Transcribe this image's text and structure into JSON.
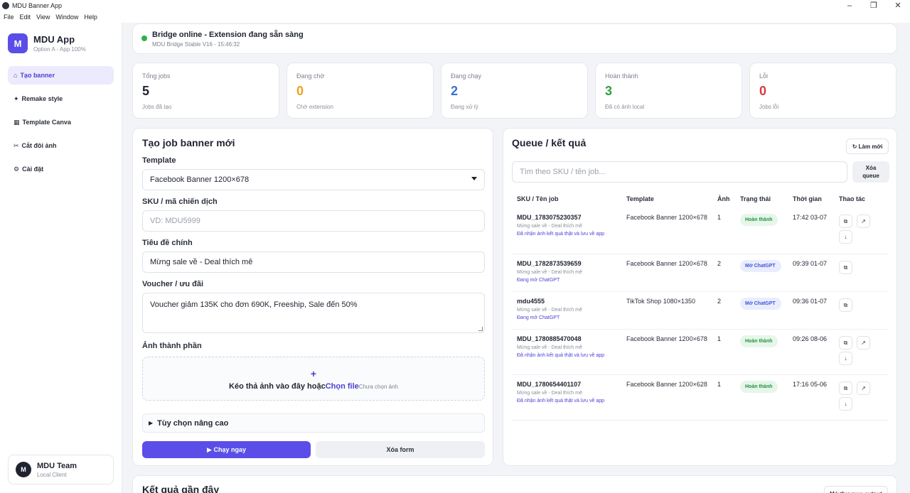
{
  "window": {
    "title": "MDU Banner App",
    "controls": {
      "minimize": "–",
      "maximize": "❐",
      "close": "✕"
    }
  },
  "menu": [
    "File",
    "Edit",
    "View",
    "Window",
    "Help"
  ],
  "sidebar": {
    "logo_letter": "M",
    "app_name": "MDU App",
    "app_sub": "Option A - App 100%",
    "items": [
      {
        "icon": "⌂",
        "label": "Tạo banner",
        "active": true
      },
      {
        "icon": "✦",
        "label": "Remake style"
      },
      {
        "icon": "▦",
        "label": "Template Canva"
      },
      {
        "icon": "✂",
        "label": "Cắt đôi ảnh"
      },
      {
        "icon": "⚙",
        "label": "Cài đặt"
      }
    ],
    "team": {
      "avatar": "M",
      "name": "MDU Team",
      "sub": "Local Client"
    }
  },
  "status": {
    "title": "Bridge online - Extension đang sẵn sàng",
    "sub": "MDU Bridge Stable V16 - 15:46:32",
    "color": "#2bb24c"
  },
  "stats": [
    {
      "label": "Tổng jobs",
      "value": "5",
      "sub": "Jobs đã tạo",
      "color": "#1f2330"
    },
    {
      "label": "Đang chờ",
      "value": "0",
      "sub": "Chờ extension",
      "color": "#f0a020"
    },
    {
      "label": "Đang chạy",
      "value": "2",
      "sub": "Đang xử lý",
      "color": "#3b6fd6"
    },
    {
      "label": "Hoàn thành",
      "value": "3",
      "sub": "Đã có ảnh local",
      "color": "#2f9e44"
    },
    {
      "label": "Lỗi",
      "value": "0",
      "sub": "Jobs lỗi",
      "color": "#d93a3a"
    }
  ],
  "form": {
    "title": "Tạo job banner mới",
    "template_label": "Template",
    "template_value": "Facebook Banner 1200×678",
    "sku_label": "SKU / mã chiến dịch",
    "sku_placeholder": "VD: MDU5999",
    "headline_label": "Tiêu đề chính",
    "headline_value": "Mừng sale về - Deal thích mê",
    "voucher_label": "Voucher / ưu đãi",
    "voucher_value": "Voucher giảm 135K cho đơn 690K, Freeship, Sale đến 50%",
    "images_label": "Ảnh thành phần",
    "drop_plus": "+",
    "drop_text": "Kéo thả ảnh vào đây hoặc",
    "drop_link": "Chọn file",
    "drop_none": "Chưa chọn ảnh",
    "advanced_label": "Tùy chọn nâng cao",
    "run_label": "▶ Chạy ngay",
    "clear_label": "Xóa form"
  },
  "queue": {
    "title": "Queue / kết quả",
    "refresh_label": "↻ Làm mới",
    "search_placeholder": "Tìm theo SKU / tên job...",
    "clear_label_1": "Xóa",
    "clear_label_2": "queue",
    "headers": {
      "sku": "SKU / Tên job",
      "template": "Template",
      "count": "Ảnh",
      "status": "Trạng thái",
      "time": "Thời gian",
      "actions": "Thao tác"
    },
    "rows": [
      {
        "sku": "MDU_1783075230357",
        "desc": "Mừng sale về - Deal thích mê",
        "note": "Đã nhận ảnh kết quả thật và lưu về app",
        "template": "Facebook Banner 1200×678",
        "count": "1",
        "status": "Hoàn thành",
        "status_type": "done",
        "time": "17:42 03-07",
        "actions": [
          "⧉",
          "↗",
          "↓"
        ]
      },
      {
        "sku": "MDU_1782873539659",
        "desc": "Mừng sale về - Deal thích mê",
        "note": "Đang mở ChatGPT",
        "template": "Facebook Banner 1200×678",
        "count": "2",
        "status": "Mở ChatGPT",
        "status_type": "open",
        "time": "09:39 01-07",
        "actions": [
          "⧉"
        ]
      },
      {
        "sku": "mdu4555",
        "desc": "Mừng sale về - Deal thích mê",
        "note": "Đang mở ChatGPT",
        "template": "TikTok Shop 1080×1350",
        "count": "2",
        "status": "Mở ChatGPT",
        "status_type": "open",
        "time": "09:36 01-07",
        "actions": [
          "⧉"
        ]
      },
      {
        "sku": "MDU_1780885470048",
        "desc": "Mừng sale về - Deal thích mê",
        "note": "Đã nhận ảnh kết quả thật và lưu về app",
        "template": "Facebook Banner 1200×678",
        "count": "1",
        "status": "Hoàn thành",
        "status_type": "done",
        "time": "09:26 08-06",
        "actions": [
          "⧉",
          "↗",
          "↓"
        ]
      },
      {
        "sku": "MDU_1780654401107",
        "desc": "Mừng sale về - Deal thích mê",
        "note": "Đã nhận ảnh kết quả thật và lưu về app",
        "template": "Facebook Banner 1200×628",
        "count": "1",
        "status": "Hoàn thành",
        "status_type": "done",
        "time": "17:16 05-06",
        "actions": [
          "⧉",
          "↗",
          "↓"
        ]
      }
    ]
  },
  "recent": {
    "title": "Kết quả gần đây",
    "open_output": "Mở thư mục output"
  }
}
